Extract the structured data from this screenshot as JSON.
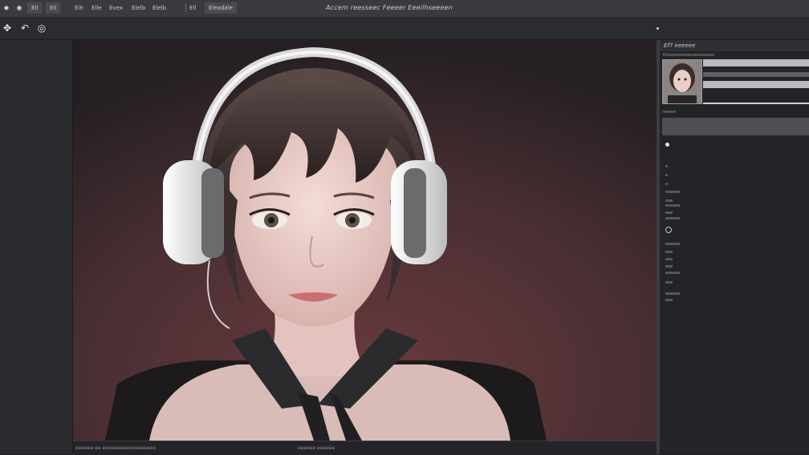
{
  "menubar": {
    "items": [
      "Ell",
      "Ell",
      "Elh",
      "Elle",
      "Evex",
      "Elelb"
    ],
    "tab_label": "Eleadale",
    "title": "Accem  reesseec  Feeeer  Eeeilhseeeen"
  },
  "toolbar": {
    "tools": [
      {
        "icon": "move-icon",
        "glyph": "✥"
      },
      {
        "icon": "undo-icon",
        "glyph": "↶"
      },
      {
        "icon": "target-icon",
        "glyph": "◎"
      }
    ]
  },
  "canvas": {
    "image_alt": "",
    "background_top": "#2b2528",
    "background_bottom": "#6a3a3e"
  },
  "statusbar": {
    "left_text": "eeeeee  ee  eeeeeeeeeeeeeeeeee",
    "center_text": "eeeeee  eeeeee"
  },
  "right_panel": {
    "header": "Ef7  eeeeee",
    "subheader": "Eleleeeeeeeeeeeeeeeeee",
    "section_label": "ieeeee",
    "properties": [
      "e",
      "e",
      "e",
      "eeeeee",
      "eee",
      "eeeeee",
      "eee",
      "eeeeee",
      "eee",
      "eeeeee",
      "eee",
      "eee",
      "eee",
      "eeeeee",
      "eee",
      "eeeeee"
    ]
  },
  "colors": {
    "menubar_bg": "#3a3b3e",
    "panel_bg": "#232427",
    "canvas_tint": "#6a3a3e"
  }
}
